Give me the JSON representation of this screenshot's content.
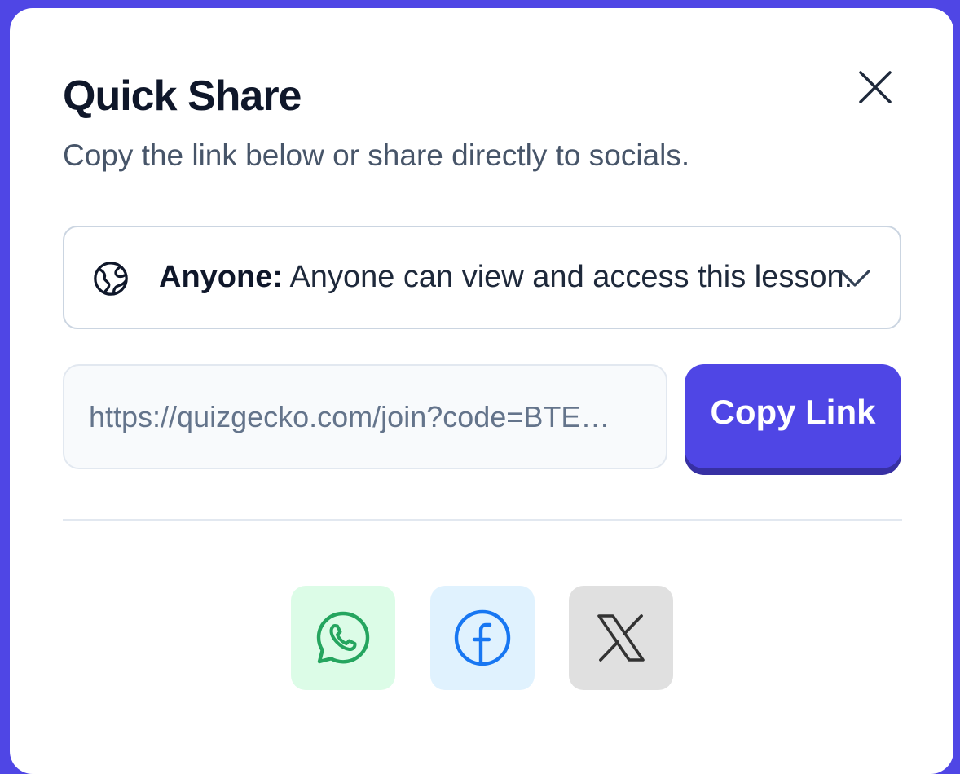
{
  "modal": {
    "title": "Quick Share",
    "subtitle": "Copy the link below or share directly to socials."
  },
  "access": {
    "level": "Anyone:",
    "description": " Anyone can view and access this lesson.",
    "icon": "globe-icon"
  },
  "link": {
    "value": "https://quizgecko.com/join?code=BTE…"
  },
  "actions": {
    "copy_label": "Copy Link"
  },
  "social": {
    "items": [
      {
        "name": "whatsapp-icon",
        "color": "#25a55f",
        "bg": "#dcfce7"
      },
      {
        "name": "facebook-icon",
        "color": "#1877f2",
        "bg": "#e0f2fe"
      },
      {
        "name": "x-icon",
        "color": "#333333",
        "bg": "#e0e0e0"
      }
    ]
  },
  "colors": {
    "accent": "#4f46e5",
    "accent_shadow": "#3730a3"
  }
}
